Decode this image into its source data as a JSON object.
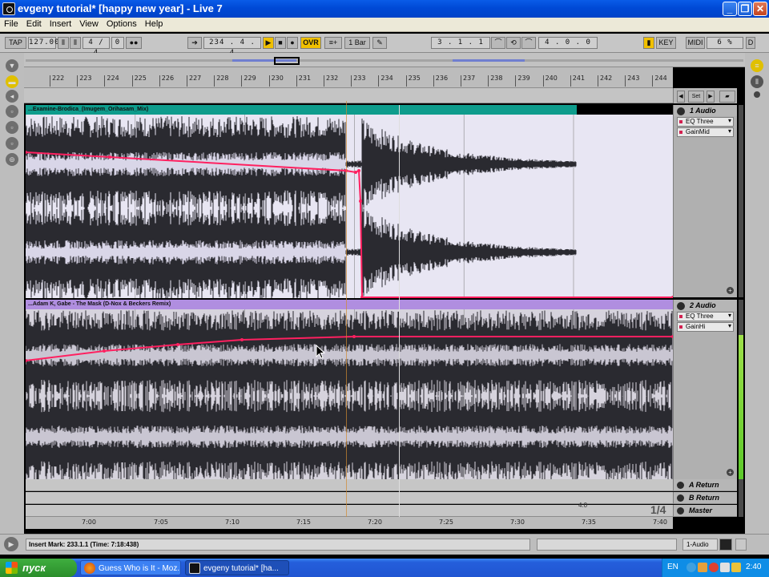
{
  "window": {
    "title": "evgeny tutorial*  [happy new year]  - Live 7"
  },
  "menu": [
    "File",
    "Edit",
    "Insert",
    "View",
    "Options",
    "Help"
  ],
  "control_bar": {
    "tap": "TAP",
    "tempo": "127.00",
    "signature": "4 / 4",
    "metro_value": "0",
    "position": "234 .  4 .  4",
    "ovr": "OVR",
    "quantize": "1 Bar",
    "loop_start": "3 .  1 .  1",
    "loop_length": "4 .  0 .  0",
    "key": "KEY",
    "midi": "MIDI",
    "cpu": "6 %",
    "disk": "D"
  },
  "ruler": {
    "bars": [
      "222",
      "223",
      "224",
      "225",
      "226",
      "227",
      "228",
      "229",
      "230",
      "231",
      "232",
      "233",
      "234",
      "235",
      "236",
      "237",
      "238",
      "239",
      "240",
      "241",
      "242",
      "243",
      "244"
    ]
  },
  "set_label": "Set",
  "tracks": [
    {
      "name": "1 Audio",
      "clip": "...Examine-Brodica_(Imugem_Orihasam_Mix)",
      "devices": [
        "EQ Three",
        "GainMid"
      ]
    },
    {
      "name": "2 Audio",
      "clip": "...Adam K, Gabe - The Mask (D-Nox & Beckers Remix)",
      "devices": [
        "EQ Three",
        "GainHi"
      ]
    }
  ],
  "returns": [
    "A Return",
    "B Return",
    "Master"
  ],
  "time_ruler": [
    "7:00",
    "7:05",
    "7:10",
    "7:15",
    "7:20",
    "7:25",
    "7:30",
    "7:35",
    "7:40"
  ],
  "master_info": {
    "scale": "4.0",
    "rate": "1/4"
  },
  "status": {
    "text": "Insert Mark: 233.1.1 (Time: 7:18:438)",
    "track": "1-Audio"
  },
  "taskbar": {
    "start": "пуск",
    "tasks": [
      "Guess Who is It - Moz...",
      "evgeny tutorial*  [ha..."
    ],
    "lang": "EN",
    "clock": "2:40"
  },
  "colors": {
    "clip1": "#0e9c8c",
    "clip2": "#b08ee0",
    "automation": "#ff2060",
    "accent": "#f0c000"
  }
}
